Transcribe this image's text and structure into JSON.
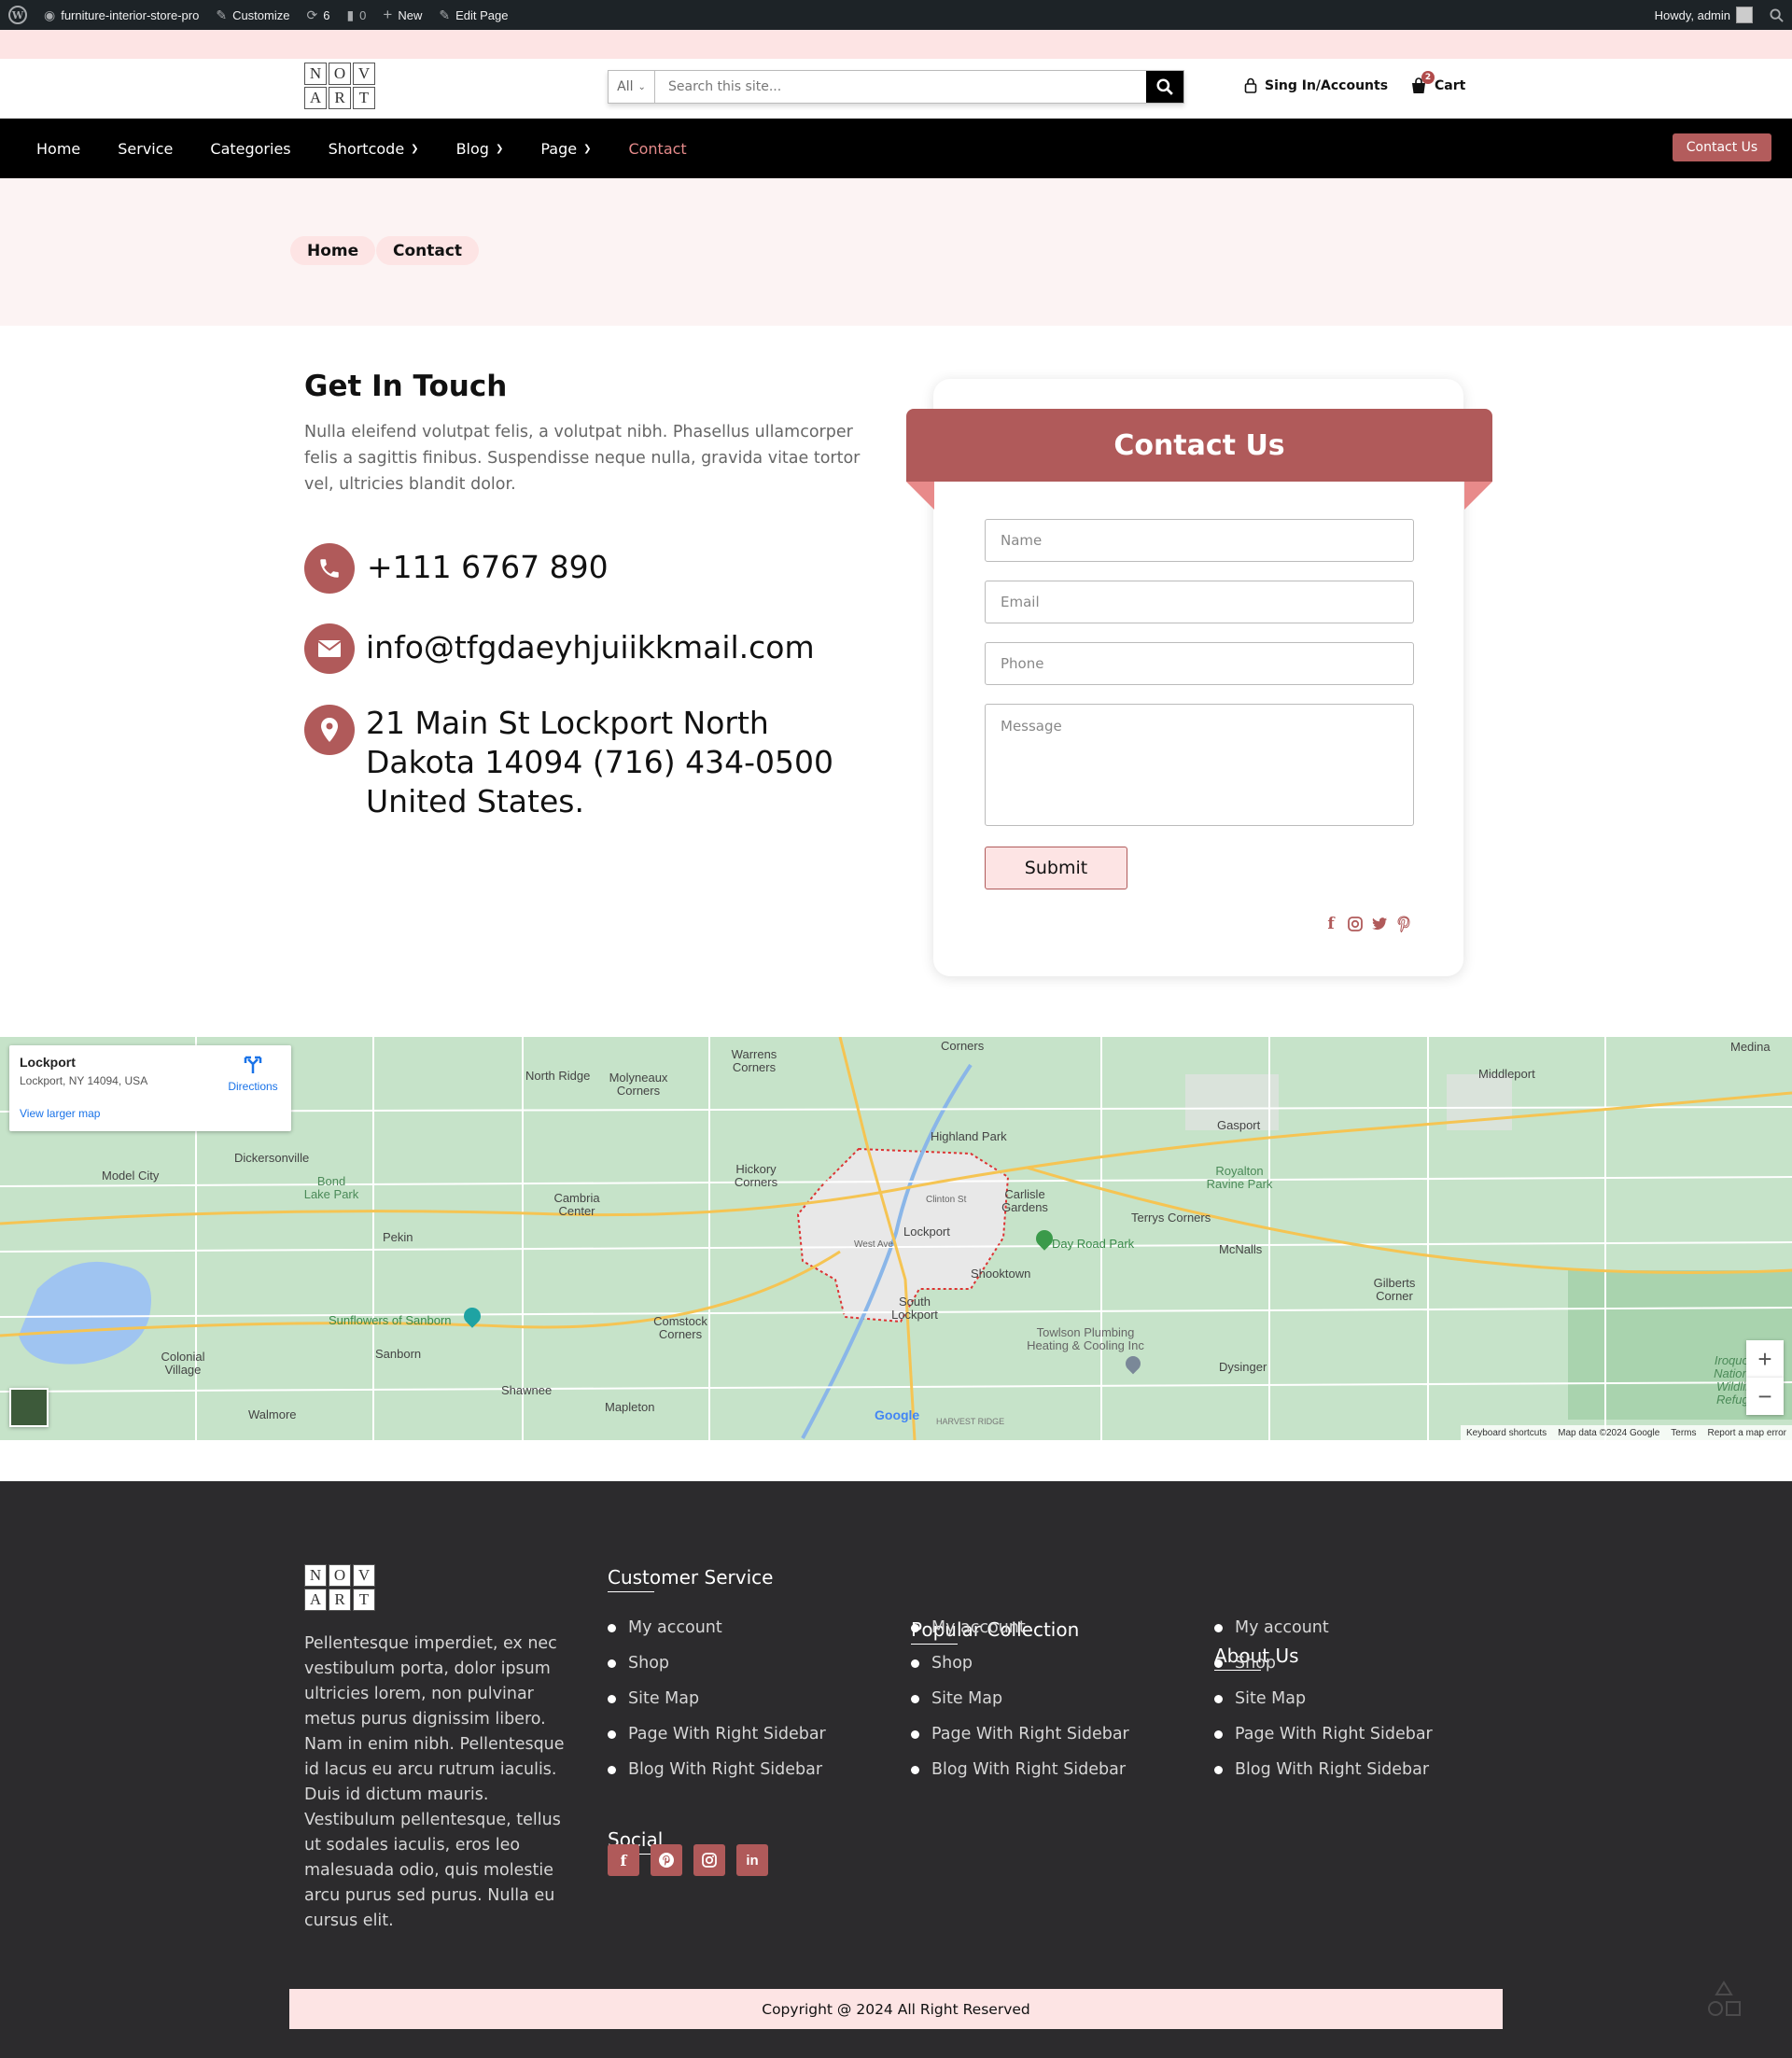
{
  "admin_bar": {
    "site_name": "furniture-interior-store-pro",
    "customize": "Customize",
    "updates_count": "6",
    "comments_count": "0",
    "new_label": "New",
    "edit_page": "Edit Page",
    "howdy": "Howdy, admin"
  },
  "header": {
    "logo_letters": [
      "N",
      "O",
      "V",
      "A",
      "R",
      "T"
    ],
    "search_category": "All",
    "search_placeholder": "Search this site...",
    "sign_in": "Sing In/Accounts",
    "cart_label": "Cart",
    "cart_count": "2"
  },
  "nav": {
    "items": [
      {
        "label": "Home",
        "dropdown": false
      },
      {
        "label": "Service",
        "dropdown": false
      },
      {
        "label": "Categories",
        "dropdown": false
      },
      {
        "label": "Shortcode",
        "dropdown": true
      },
      {
        "label": "Blog",
        "dropdown": true
      },
      {
        "label": "Page",
        "dropdown": true
      },
      {
        "label": "Contact",
        "dropdown": false,
        "active": true
      }
    ],
    "cta": "Contact Us"
  },
  "breadcrumb": [
    "Home",
    "Contact"
  ],
  "contact_info": {
    "title": "Get In Touch",
    "text": "Nulla eleifend volutpat felis, a volutpat nibh. Phasellus ullamcorper felis a sagittis finibus. Suspendisse neque nulla, gravida vitae tortor vel, ultricies blandit dolor.",
    "phone": "+111 6767 890",
    "email": "info@tfgdaeyhjuiikkmail.com",
    "address": "21 Main St Lockport North Dakota 14094 (716) 434-0500 United States."
  },
  "contact_form": {
    "title": "Contact Us",
    "name_placeholder": "Name",
    "email_placeholder": "Email",
    "phone_placeholder": "Phone",
    "message_placeholder": "Message",
    "submit": "Submit",
    "social_icons": [
      "facebook-icon",
      "instagram-icon",
      "twitter-icon",
      "pinterest-icon"
    ]
  },
  "map": {
    "place_name": "Lockport",
    "place_address": "Lockport, NY 14094, USA",
    "directions": "Directions",
    "view_larger": "View larger map",
    "footer_links": [
      "Keyboard shortcuts",
      "Map data ©2024 Google",
      "Terms",
      "Report a map error"
    ],
    "google": "Google",
    "labels": [
      "Medina",
      "Middleport",
      "Gasport",
      "Royalton Ravine Park",
      "McNalls",
      "Gilberts Corner",
      "Dysinger",
      "Terrys Corners",
      "Day Road Park",
      "Towlson Plumbing Heating & Cooling Inc",
      "Carlisle Gardens",
      "Lockport",
      "Shooktown",
      "South Lockport",
      "Highland Park",
      "Hickory Corners",
      "Cambria Center",
      "Comstock Corners",
      "Warrens Corners",
      "North Ridge",
      "Molyneaux Corners",
      "Dickersonville",
      "Bond Lake Park",
      "Model City",
      "Pekin",
      "Sunflowers of Sanborn",
      "Sanborn",
      "Colonial Village",
      "Shawnee",
      "Mapleton",
      "Walmore",
      "Iroquois National Wildlife Refuge",
      "HARVEST RIDGE",
      "West Ave",
      "Clinton St",
      "Corners"
    ]
  },
  "footer": {
    "about": "Pellentesque imperdiet, ex nec vestibulum porta, dolor ipsum ultricies lorem, non pulvinar metus purus dignissim libero. Nam in enim nibh. Pellentesque id lacus eu arcu rutrum iaculis. Duis id dictum mauris. Vestibulum pellentesque, tellus ut sodales iaculis, eros leo malesuada odio, quis molestie arcu purus sed purus. Nulla eu cursus elit.",
    "columns": [
      {
        "title": "Customer Service",
        "links": [
          "My account",
          "Shop",
          "Site Map",
          "Page With Right Sidebar",
          "Blog With Right Sidebar"
        ]
      },
      {
        "title": "Popular Collection",
        "links": [
          "My account",
          "Shop",
          "Site Map",
          "Page With Right Sidebar",
          "Blog With Right Sidebar"
        ]
      },
      {
        "title": "About Us",
        "links": [
          "My account",
          "Shop",
          "Site Map",
          "Page With Right Sidebar",
          "Blog With Right Sidebar"
        ]
      }
    ],
    "social_title": "Social",
    "social_icons": [
      "facebook-icon",
      "pinterest-icon",
      "instagram-icon",
      "linkedin-icon"
    ],
    "copyright": "Copyright @ 2024 All Right Reserved"
  },
  "colors": {
    "accent": "#b05a5a",
    "pink_light": "#fde4e4",
    "nav_bg": "#000000",
    "footer_bg": "#2c2b2d",
    "admin_bg": "#1d2327"
  }
}
